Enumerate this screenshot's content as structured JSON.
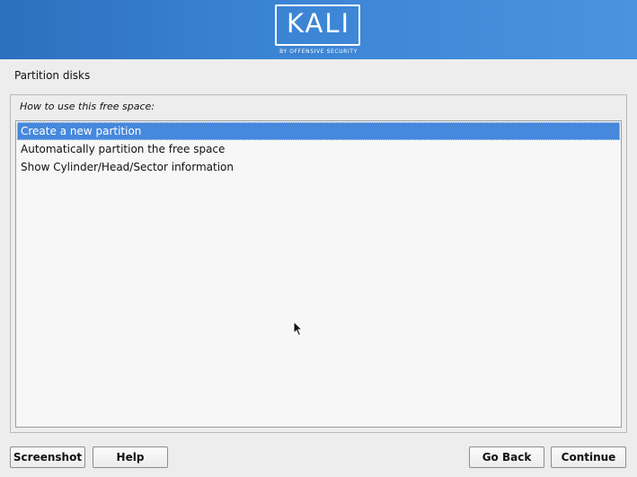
{
  "branding": {
    "logo_text": "KALI",
    "logo_subtext": "BY OFFENSIVE SECURITY"
  },
  "page": {
    "title": "Partition disks",
    "prompt": "How to use this free space:"
  },
  "options": [
    {
      "label": "Create a new partition",
      "selected": true
    },
    {
      "label": "Automatically partition the free space",
      "selected": false
    },
    {
      "label": "Show Cylinder/Head/Sector information",
      "selected": false
    }
  ],
  "buttons": {
    "screenshot": "Screenshot",
    "help": "Help",
    "go_back": "Go Back",
    "continue": "Continue"
  },
  "colors": {
    "banner": "#3a83d3",
    "selection": "#4688dc",
    "background": "#ededed"
  }
}
